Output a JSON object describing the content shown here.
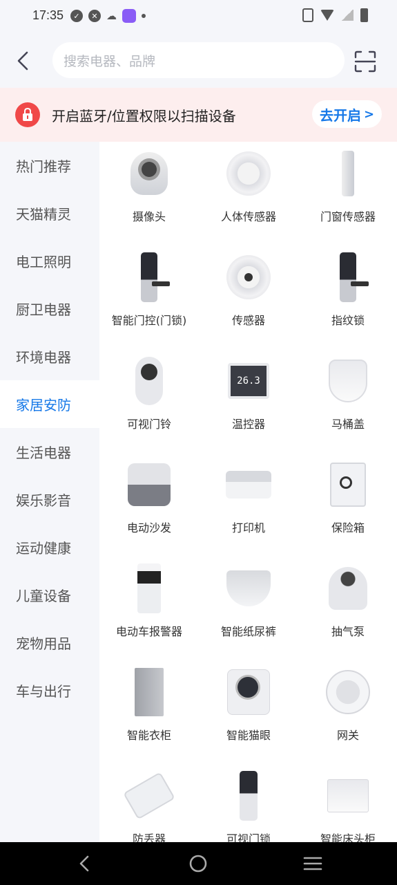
{
  "status_bar": {
    "time": "17:35",
    "left_icons": [
      "check-circle-icon",
      "shield-icon",
      "cloud-icon",
      "app-notification-icon",
      "dot-icon"
    ],
    "right_icons": [
      "vibrate-icon",
      "wifi-icon",
      "signal-icon",
      "battery-icon"
    ]
  },
  "header": {
    "back_icon": "chevron-left-icon",
    "search_placeholder": "搜索电器、品牌",
    "scan_icon": "scan-icon"
  },
  "banner": {
    "icon": "lock-icon",
    "text": "开启蓝牙/位置权限以扫描设备",
    "button_label": "去开启",
    "button_chevron": ">",
    "accent": "#1678e8",
    "badge_color": "#f04848"
  },
  "sidebar": {
    "items": [
      {
        "label": "热门推荐"
      },
      {
        "label": "天猫精灵"
      },
      {
        "label": "电工照明"
      },
      {
        "label": "厨卫电器"
      },
      {
        "label": "环境电器"
      },
      {
        "label": "家居安防"
      },
      {
        "label": "生活电器"
      },
      {
        "label": "娱乐影音"
      },
      {
        "label": "运动健康"
      },
      {
        "label": "儿童设备"
      },
      {
        "label": "宠物用品"
      },
      {
        "label": "车与出行"
      }
    ],
    "active_index": 5
  },
  "products": [
    {
      "label": "摄像头",
      "icon": "camera-product"
    },
    {
      "label": "人体传感器",
      "icon": "motion-sensor-product"
    },
    {
      "label": "门窗传感器",
      "icon": "door-window-sensor-product"
    },
    {
      "label": "智能门控(门锁)",
      "icon": "smart-door-lock-product"
    },
    {
      "label": "传感器",
      "icon": "sensor-product"
    },
    {
      "label": "指纹锁",
      "icon": "fingerprint-lock-product"
    },
    {
      "label": "可视门铃",
      "icon": "video-doorbell-product"
    },
    {
      "label": "温控器",
      "icon": "thermostat-product",
      "display": "26.3"
    },
    {
      "label": "马桶盖",
      "icon": "toilet-seat-product"
    },
    {
      "label": "电动沙发",
      "icon": "power-sofa-product"
    },
    {
      "label": "打印机",
      "icon": "printer-product"
    },
    {
      "label": "保险箱",
      "icon": "safe-product"
    },
    {
      "label": "电动车报警器",
      "icon": "ebike-alarm-product"
    },
    {
      "label": "智能纸尿裤",
      "icon": "smart-diaper-product"
    },
    {
      "label": "抽气泵",
      "icon": "air-pump-product"
    },
    {
      "label": "智能衣柜",
      "icon": "smart-wardrobe-product"
    },
    {
      "label": "智能猫眼",
      "icon": "smart-peephole-product"
    },
    {
      "label": "网关",
      "icon": "gateway-product"
    },
    {
      "label": "防丢器",
      "icon": "anti-lost-tracker-product"
    },
    {
      "label": "可视门锁",
      "icon": "video-door-lock-product"
    },
    {
      "label": "智能床头柜",
      "icon": "smart-nightstand-product"
    }
  ],
  "nav_bar": {
    "icons": [
      "nav-back-icon",
      "nav-home-icon",
      "nav-recents-icon"
    ]
  }
}
